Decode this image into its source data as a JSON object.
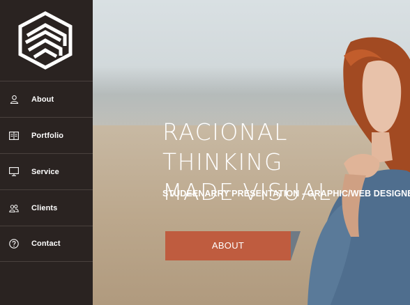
{
  "sidebar": {
    "items": [
      {
        "label": "About",
        "icon": "user-icon"
      },
      {
        "label": "Portfolio",
        "icon": "portfolio-icon"
      },
      {
        "label": "Service",
        "icon": "monitor-icon"
      },
      {
        "label": "Clients",
        "icon": "clients-icon"
      },
      {
        "label": "Contact",
        "icon": "help-icon"
      }
    ]
  },
  "hero": {
    "headline_line1": "RACIONAL THINKING",
    "headline_line2": "MADE VISUAL",
    "subtitle": "STUDEENARRY PRESENTATION - GRAPHIC/WEB DESIGNER",
    "button_label": "ABOUT"
  },
  "colors": {
    "sidebar_bg": "#2a2321",
    "accent": "#bf5c3f"
  }
}
